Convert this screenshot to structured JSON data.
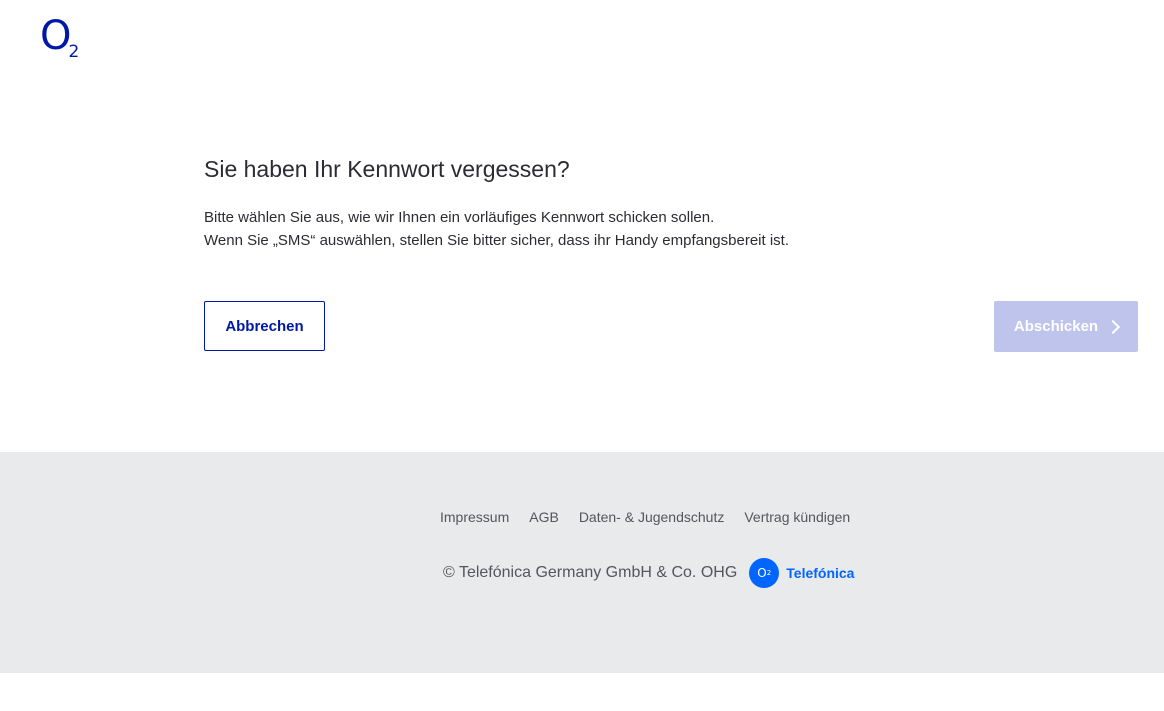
{
  "brand": {
    "logo_main": "O",
    "logo_sub": "2"
  },
  "main": {
    "title": "Sie haben Ihr Kennwort vergessen?",
    "description_line1": "Bitte wählen Sie aus, wie wir Ihnen ein vorläufiges Kennwort schicken sollen.",
    "description_line2": "Wenn Sie „SMS“ auswählen, stellen Sie bitter sicher, dass ihr Handy empfangsbereit ist.",
    "cancel_label": "Abbrechen",
    "submit_label": "Abschicken"
  },
  "footer": {
    "links": [
      "Impressum",
      "AGB",
      "Daten- & Jugendschutz",
      "Vertrag kündigen"
    ],
    "copyright": "© Telefónica Germany GmbH & Co. OHG",
    "telefonica_logo_main": "O",
    "telefonica_logo_sub": "2",
    "telefonica_name": "Telefónica"
  },
  "colors": {
    "brand_blue": "#0019a5",
    "submit_disabled": "#bfc4ec",
    "footer_bg": "#e9eaeb",
    "telefonica_blue": "#0066ff"
  }
}
